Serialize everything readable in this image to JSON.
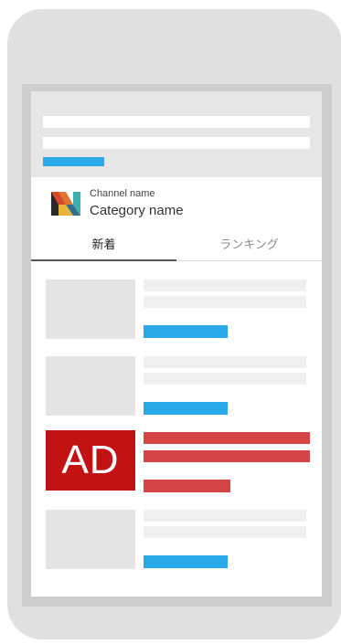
{
  "header": {
    "channel_name": "Channel name",
    "category_name": "Category name",
    "logo_icon": "n-logo-icon"
  },
  "tabs": [
    {
      "label": "新着",
      "active": true
    },
    {
      "label": "ランキング",
      "active": false
    }
  ],
  "ad": {
    "label": "AD"
  },
  "colors": {
    "accent": "#29a9e8",
    "ad_red": "#c21212",
    "ad_line": "#d54545",
    "placeholder": "#e4e4e4"
  }
}
